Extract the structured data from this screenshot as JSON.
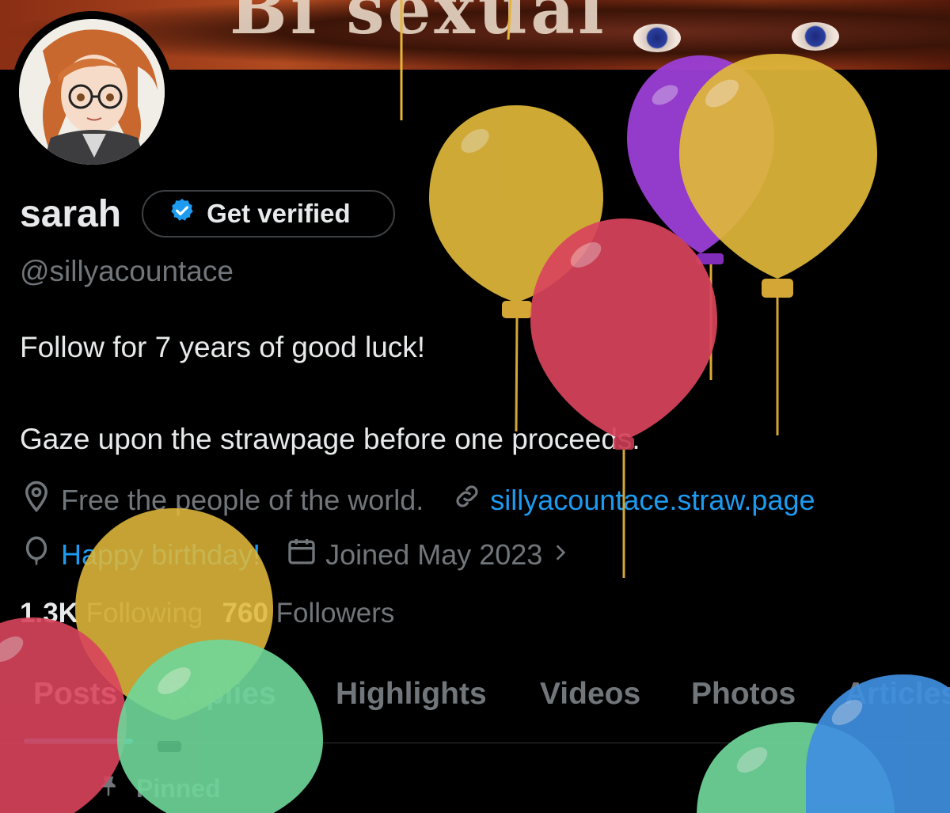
{
  "banner": {
    "text": "Bi sexual"
  },
  "profile": {
    "display_name": "sarah",
    "verify_label": "Get verified",
    "handle": "@sillyacountace",
    "bio_line1": "Follow for 7 years of good luck!",
    "bio_line2": "Gaze upon the strawpage before one proceeds.",
    "location": "Free the people of the world.",
    "website": "sillyacountace.straw.page",
    "birthday": "Happy birthday!",
    "joined": "Joined May 2023",
    "following_count": "1.3K",
    "following_label": "Following",
    "followers_count": "760",
    "followers_label": "Followers"
  },
  "tabs": [
    {
      "label": "Posts",
      "active": true
    },
    {
      "label": "Replies",
      "active": false
    },
    {
      "label": "Highlights",
      "active": false
    },
    {
      "label": "Videos",
      "active": false
    },
    {
      "label": "Photos",
      "active": false
    },
    {
      "label": "Articles",
      "active": false
    }
  ],
  "pinned_label": "Pinned",
  "icons": {
    "verify": "verified-badge-icon",
    "location": "location-pin-icon",
    "link": "link-icon",
    "birthday": "balloon-icon",
    "calendar": "calendar-icon",
    "chevron": "chevron-right-icon",
    "pin": "pin-icon"
  },
  "colors": {
    "background": "#000000",
    "text_primary": "#e7e9ea",
    "text_secondary": "#71767b",
    "accent": "#1d9bf0",
    "balloon_yellow": "#e0b83a",
    "balloon_red": "#d9445c",
    "balloon_purple": "#9b3fd6",
    "balloon_green": "#6fd79a",
    "balloon_blue": "#3f8fe0"
  }
}
